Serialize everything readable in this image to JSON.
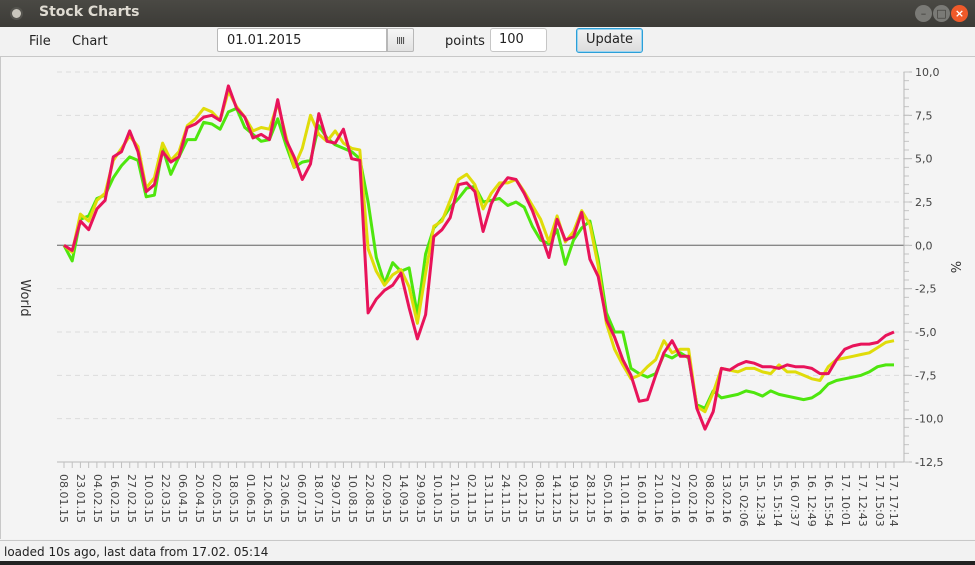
{
  "window": {
    "title": "Stock Charts"
  },
  "menu": {
    "file": "File",
    "chart": "Chart"
  },
  "toolbar": {
    "start_date": "01.01.2015",
    "calendar_icon": "calendar-icon",
    "points_label": "points",
    "points_value": "100",
    "update_label": "Update"
  },
  "status": {
    "text": "loaded 10s ago, last data from 17.02. 05:14"
  },
  "colors": {
    "series_red": "#e8135a",
    "series_yellow": "#e0dc0a",
    "series_green": "#4ee60e",
    "zero_line": "#888888"
  },
  "chart_data": {
    "type": "line",
    "title": "",
    "xlabel": "",
    "ylabel": "World",
    "y2label": "%",
    "ylim": [
      -12.5,
      10.0
    ],
    "yticks": [
      "10,0",
      "7,5",
      "5,0",
      "2,5",
      "0,0",
      "-2,5",
      "-5,0",
      "-7,5",
      "-10,0",
      "-12,5"
    ],
    "ytick_values": [
      10.0,
      7.5,
      5.0,
      2.5,
      0.0,
      -2.5,
      -5.0,
      -7.5,
      -10.0,
      -12.5
    ],
    "grid": true,
    "legend": "none",
    "x_tick_labels": [
      "08.01.15",
      "23.01.15",
      "04.02.15",
      "16.02.15",
      "27.02.15",
      "10.03.15",
      "22.03.15",
      "06.04.15",
      "20.04.15",
      "02.05.15",
      "18.05.15",
      "01.06.15",
      "12.06.15",
      "23.06.15",
      "06.07.15",
      "18.07.15",
      "29.07.15",
      "10.08.15",
      "22.08.15",
      "02.09.15",
      "14.09.15",
      "29.09.15",
      "10.10.15",
      "21.10.15",
      "02.11.15",
      "13.11.15",
      "24.11.15",
      "02.12.15",
      "08.12.15",
      "14.12.15",
      "19.12.15",
      "28.12.15",
      "05.01.16",
      "11.01.16",
      "16.01.16",
      "21.01.16",
      "27.01.16",
      "02.02.16",
      "08.02.16",
      "13.02.16",
      "15. 02:06",
      "15. 12:34",
      "15. 15:14",
      "16. 07:37",
      "16. 12:49",
      "16. 15:54",
      "17. 10:01",
      "17. 12:43",
      "17. 15:03",
      "17. 17:14"
    ],
    "series": [
      {
        "name": "red",
        "color": "#e8135a",
        "values": [
          0.0,
          -0.3,
          1.4,
          0.9,
          2.1,
          2.6,
          5.1,
          5.4,
          6.6,
          5.4,
          3.1,
          3.5,
          5.4,
          4.8,
          5.1,
          6.8,
          7.0,
          7.4,
          7.5,
          7.2,
          9.2,
          7.9,
          7.4,
          6.2,
          6.4,
          6.1,
          8.4,
          6.1,
          5.1,
          3.8,
          4.7,
          7.6,
          6.0,
          5.9,
          6.7,
          5.0,
          4.9,
          -3.9,
          -3.1,
          -2.6,
          -2.3,
          -1.6,
          -3.6,
          -5.4,
          -4.0,
          0.5,
          0.9,
          1.6,
          3.5,
          3.6,
          3.1,
          0.8,
          2.4,
          3.3,
          3.9,
          3.8,
          3.0,
          2.0,
          0.7,
          -0.7,
          1.5,
          0.3,
          0.5,
          1.9,
          -0.8,
          -1.8,
          -4.3,
          -5.3,
          -6.6,
          -7.5,
          -9.0,
          -8.9,
          -7.5,
          -6.2,
          -5.5,
          -6.4,
          -6.4,
          -9.4,
          -10.6,
          -9.6,
          -7.1,
          -7.2,
          -6.9,
          -6.7,
          -6.8,
          -7.0,
          -7.0,
          -7.1,
          -6.9,
          -7.0,
          -7.0,
          -7.1,
          -7.4,
          -7.4,
          -6.6,
          -6.0,
          -5.8,
          -5.7,
          -5.7,
          -5.6,
          -5.2,
          -5.0
        ]
      },
      {
        "name": "yellow",
        "color": "#e0dc0a",
        "values": [
          0.0,
          -0.4,
          1.8,
          1.4,
          2.6,
          3.0,
          4.9,
          5.6,
          6.3,
          5.7,
          3.3,
          3.9,
          5.9,
          4.9,
          5.4,
          6.9,
          7.3,
          7.9,
          7.7,
          7.2,
          8.9,
          8.0,
          7.4,
          6.6,
          6.8,
          6.7,
          8.2,
          6.3,
          4.5,
          5.6,
          7.5,
          6.4,
          6.0,
          6.6,
          5.9,
          5.6,
          5.5,
          -0.2,
          -1.5,
          -2.3,
          -1.7,
          -1.4,
          -2.4,
          -4.5,
          -1.6,
          1.1,
          1.4,
          2.6,
          3.8,
          4.1,
          3.5,
          2.1,
          3.0,
          3.6,
          3.6,
          3.8,
          3.1,
          2.3,
          1.5,
          0.2,
          1.7,
          0.2,
          0.8,
          2.0,
          1.2,
          -1.2,
          -4.5,
          -6.0,
          -6.9,
          -7.7,
          -7.5,
          -7.0,
          -6.6,
          -5.5,
          -6.2,
          -6.0,
          -6.0,
          -9.3,
          -9.6,
          -8.5,
          -7.1,
          -7.2,
          -7.3,
          -7.1,
          -7.1,
          -7.3,
          -7.4,
          -6.9,
          -7.3,
          -7.3,
          -7.5,
          -7.7,
          -7.8,
          -7.0,
          -6.6,
          -6.5,
          -6.4,
          -6.3,
          -6.2,
          -5.9,
          -5.6,
          -5.5
        ]
      },
      {
        "name": "green",
        "color": "#4ee60e",
        "values": [
          0.0,
          -0.9,
          1.5,
          1.7,
          2.7,
          2.9,
          3.9,
          4.6,
          5.1,
          4.9,
          2.8,
          2.9,
          5.6,
          4.1,
          5.1,
          6.1,
          6.1,
          7.1,
          7.0,
          6.7,
          7.7,
          7.9,
          6.8,
          6.4,
          6.0,
          6.1,
          7.3,
          5.8,
          4.5,
          4.8,
          4.9,
          6.9,
          6.2,
          5.8,
          5.6,
          5.4,
          5.0,
          2.5,
          -0.7,
          -2.2,
          -1.0,
          -1.5,
          -1.3,
          -4.0,
          -0.5,
          1.0,
          1.5,
          2.2,
          2.7,
          3.3,
          3.4,
          2.5,
          2.6,
          2.7,
          2.3,
          2.5,
          2.2,
          1.1,
          0.3,
          0.1,
          0.9,
          -1.1,
          0.3,
          1.0,
          1.4,
          -0.8,
          -3.9,
          -5.0,
          -5.0,
          -7.1,
          -7.4,
          -7.6,
          -7.4,
          -6.3,
          -6.5,
          -6.2,
          -6.5,
          -9.2,
          -9.4,
          -8.4,
          -8.8,
          -8.7,
          -8.6,
          -8.4,
          -8.5,
          -8.7,
          -8.4,
          -8.6,
          -8.7,
          -8.8,
          -8.9,
          -8.8,
          -8.5,
          -8.0,
          -7.8,
          -7.7,
          -7.6,
          -7.5,
          -7.3,
          -7.0,
          -6.9,
          -6.9
        ]
      }
    ]
  }
}
